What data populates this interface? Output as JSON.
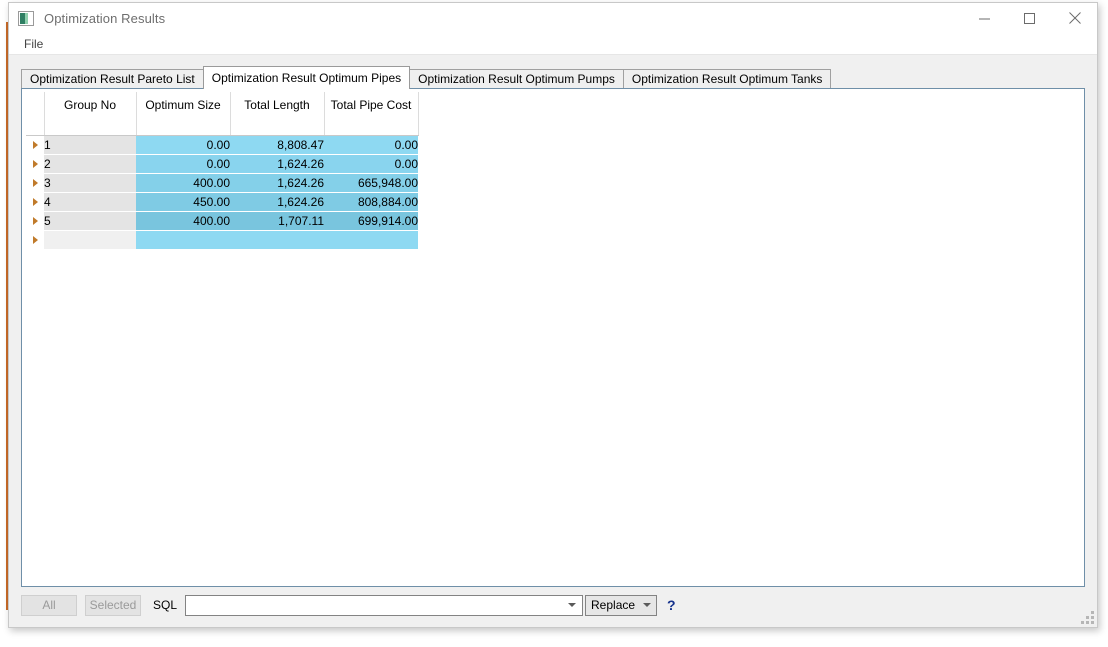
{
  "window": {
    "title": "Optimization Results",
    "icon": "app-image-icon",
    "controls": {
      "minimize": "minimize-icon",
      "maximize": "maximize-icon",
      "close": "close-icon"
    }
  },
  "menubar": {
    "items": [
      "File"
    ]
  },
  "tabs": [
    {
      "label": "Optimization Result Pareto List",
      "active": false
    },
    {
      "label": "Optimization Result Optimum Pipes",
      "active": true
    },
    {
      "label": "Optimization Result Optimum Pumps",
      "active": false
    },
    {
      "label": "Optimization Result Optimum Tanks",
      "active": false
    }
  ],
  "grid": {
    "columns": [
      "Group No",
      "Optimum Size",
      "Total Length",
      "Total Pipe Cost"
    ],
    "rows": [
      {
        "group_no": "1",
        "optimum_size": "0.00",
        "total_length": "8,808.47",
        "total_pipe_cost": "0.00",
        "cell_color": "#8ed9f2"
      },
      {
        "group_no": "2",
        "optimum_size": "0.00",
        "total_length": "1,624.26",
        "total_pipe_cost": "0.00",
        "cell_color": "#89d4ee"
      },
      {
        "group_no": "3",
        "optimum_size": "400.00",
        "total_length": "1,624.26",
        "total_pipe_cost": "665,948.00",
        "cell_color": "#84d0e9"
      },
      {
        "group_no": "4",
        "optimum_size": "450.00",
        "total_length": "1,624.26",
        "total_pipe_cost": "808,884.00",
        "cell_color": "#7fcbe4"
      },
      {
        "group_no": "5",
        "optimum_size": "400.00",
        "total_length": "1,707.11",
        "total_pipe_cost": "699,914.00",
        "cell_color": "#79c5de"
      }
    ],
    "new_row": {
      "group_no": "",
      "optimum_size": "",
      "total_length": "",
      "total_pipe_cost": "",
      "cell_color": "#8ed9f2"
    },
    "row_selector_icon": "row-selector-arrow-icon"
  },
  "bottom_bar": {
    "all_button": "All",
    "selected_button": "Selected",
    "sql_label": "SQL",
    "sql_value": "",
    "sql_placeholder": "",
    "mode_value": "Replace",
    "help_label": "?",
    "dropdown_icon": "chevron-down-icon"
  },
  "colors": {
    "accent_border": "#6f8fa8",
    "row_header_bg": "#e4e4e4",
    "help_blue": "#15328c",
    "selector_orange": "#c07a2a"
  }
}
